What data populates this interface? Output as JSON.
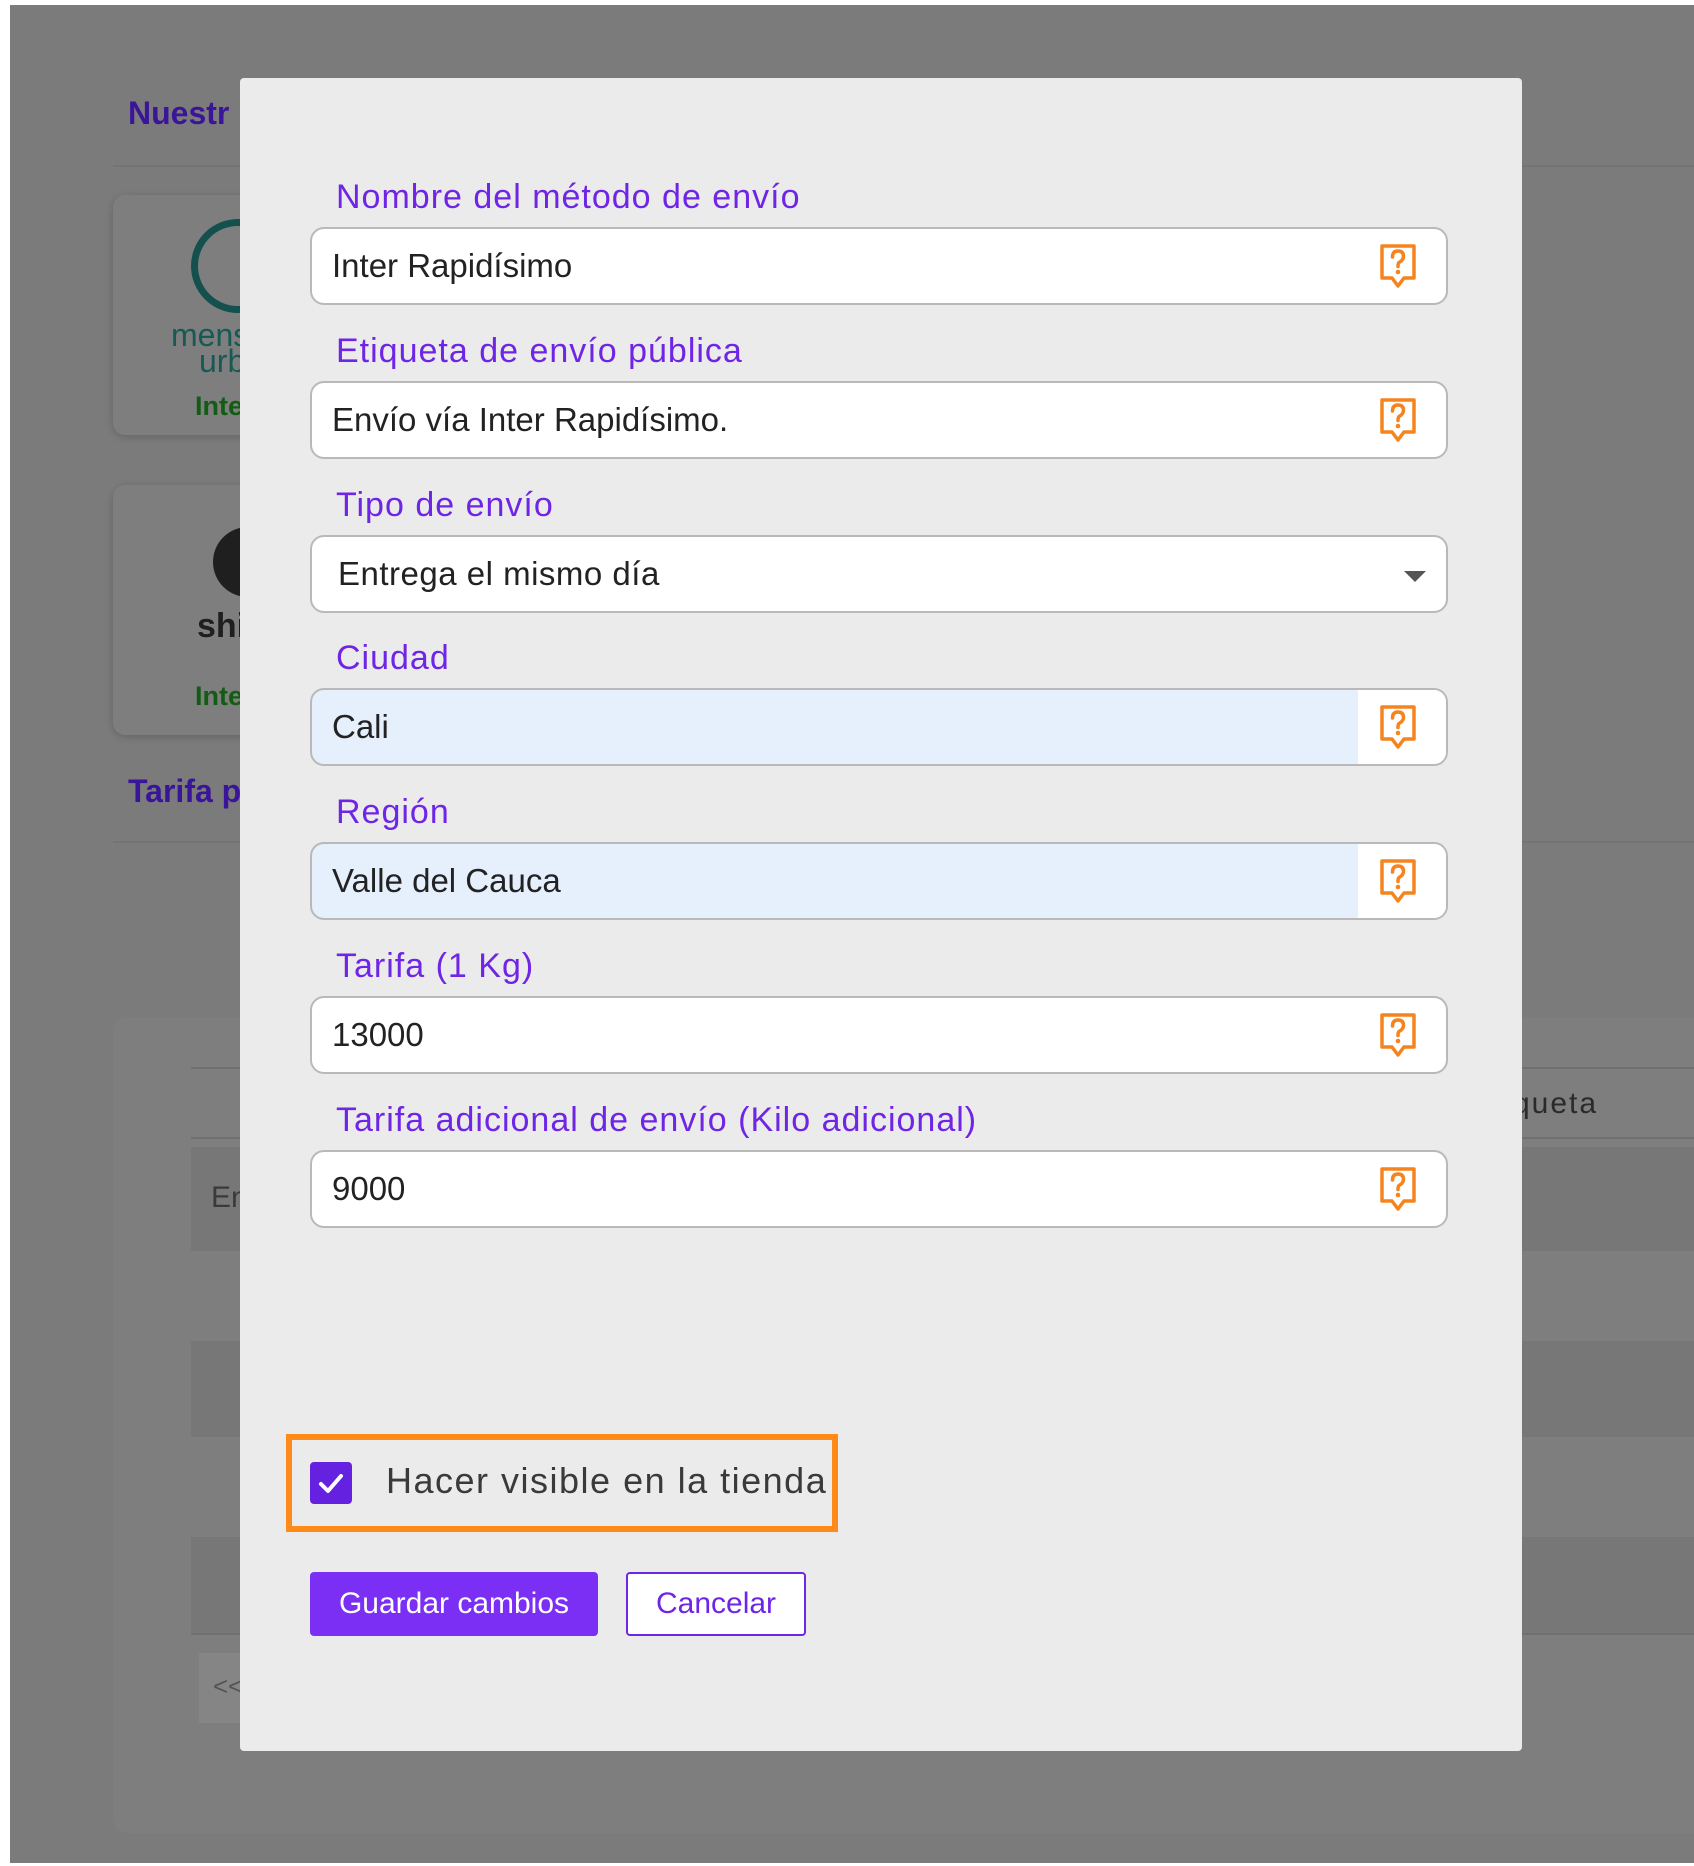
{
  "background": {
    "section_title_1": "Nuestr",
    "section_title_2": "Tarifa p",
    "card1_brand_line1": "mens",
    "card1_brand_line2": "urba",
    "card1_status": "Inte",
    "card2_brand": "shi",
    "card2_status": "Inte",
    "table_header_partial": "queta",
    "table_cell_partial": "En",
    "pagination_prev": "<<"
  },
  "form": {
    "fields": [
      {
        "label": "Nombre del método de envío",
        "value": "Inter Rapidísimo",
        "icon": "help-icon"
      },
      {
        "label": "Etiqueta de envío pública",
        "value": "Envío vía Inter Rapidísimo.",
        "icon": "help-icon"
      },
      {
        "label": "Tipo de envío",
        "value": "Entrega el mismo día",
        "icon": "chevron-down-icon"
      },
      {
        "label": "Ciudad",
        "value": "Cali",
        "icon": "help-icon"
      },
      {
        "label": "Región",
        "value": "Valle del Cauca",
        "icon": "help-icon"
      },
      {
        "label": "Tarifa (1 Kg)",
        "value": "13000",
        "icon": "help-icon"
      },
      {
        "label": "Tarifa adicional de envío (Kilo adicional)",
        "value": "9000",
        "icon": "help-icon"
      }
    ],
    "visible_checkbox": {
      "label": "Hacer visible en la tienda",
      "checked": true
    },
    "save_label": "Guardar cambios",
    "cancel_label": "Cancelar"
  },
  "colors": {
    "accent": "#6f25e6",
    "button_primary": "#7b2ff5",
    "highlight": "#ff8a1a",
    "help_icon": "#f5841f",
    "overlay": "#7b7b7b"
  }
}
